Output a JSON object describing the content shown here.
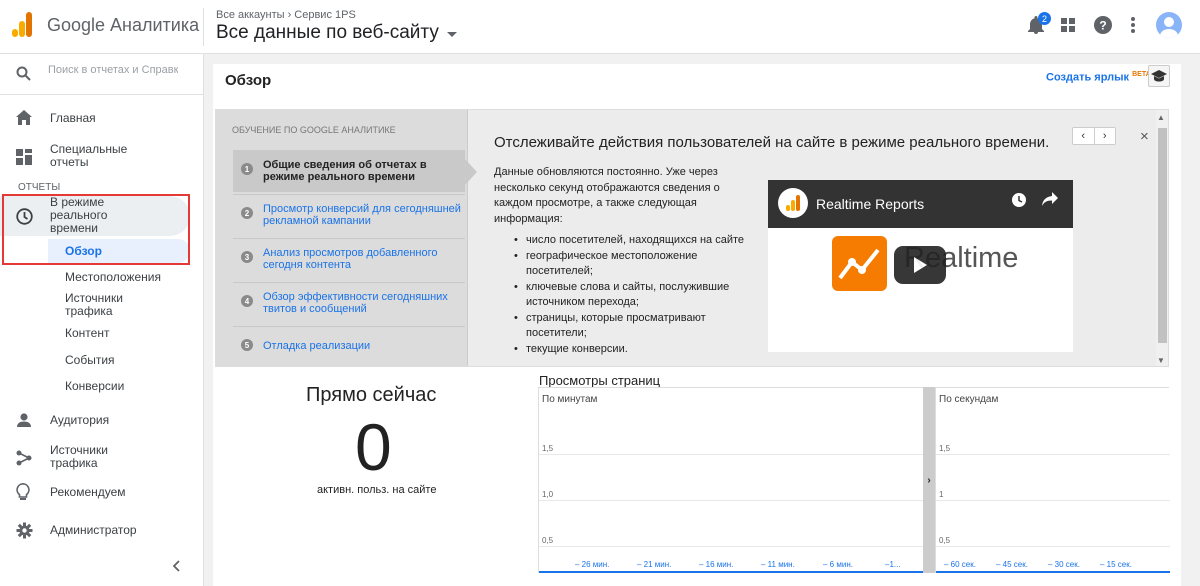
{
  "header": {
    "app_title": "Google Аналитика",
    "breadcrumb": "Все аккаунты › Сервис 1PS",
    "view_name": "Все данные по веб-сайту",
    "notification_count": "2",
    "brand_colors": {
      "logo_light": "#f9ab00",
      "logo_dark": "#e37400",
      "accent": "#1a73e8"
    }
  },
  "sidebar": {
    "search_placeholder": "Поиск в отчетах и Справке",
    "home": "Главная",
    "custom_reports": "Специальные отчеты",
    "section_reports": "ОТЧЕТЫ",
    "realtime": "В режиме реального времени",
    "realtime_sub": [
      "Обзор",
      "Местоположения",
      "Источники трафика",
      "Контент",
      "События",
      "Конверсии"
    ],
    "audience": "Аудитория",
    "acquisition": "Источники трафика",
    "recommended": "Рекомендуем",
    "admin": "Администратор"
  },
  "main": {
    "page_title": "Обзор",
    "shortcut_label": "Создать ярлык",
    "shortcut_badge": "BETA",
    "learning": {
      "heading": "ОБУЧЕНИЕ ПО GOOGLE АНАЛИТИКЕ",
      "steps": [
        {
          "num": "1",
          "label": "Общие сведения об отчетах в режиме реального времени"
        },
        {
          "num": "2",
          "label": "Просмотр конверсий для сегодняшней рекламной кампании"
        },
        {
          "num": "3",
          "label": "Анализ просмотров добавленного сегодня контента"
        },
        {
          "num": "4",
          "label": "Обзор эффективности сегодняшних твитов и сообщений"
        },
        {
          "num": "5",
          "label": "Отладка реализации"
        }
      ],
      "title": "Отслеживайте действия пользователей на сайте в режиме реального времени.",
      "body": "Данные обновляются постоянно. Уже через несколько секунд отображаются сведения о каждом просмотре, а также следующая информация:",
      "bullets": [
        "число посетителей, находящихся на сайте",
        "географическое местоположение посетителей;",
        "ключевые слова и сайты, послужившие источником перехода;",
        "страницы, которые просматривают посетители;",
        "текущие конверсии."
      ],
      "video_title": "Realtime Reports",
      "video_text": "Realtime"
    },
    "right_now": {
      "title": "Прямо сейчас",
      "value": "0",
      "subtitle": "активн. польз. на сайте"
    },
    "pageviews_title": "Просмотры страниц"
  },
  "chart_data": [
    {
      "type": "bar",
      "title": "По минутам",
      "yticks": [
        "1,5",
        "1,0",
        "0,5"
      ],
      "categories": [
        "– 26 мин.",
        "– 21 мин.",
        "– 16 мин.",
        "– 11 мин.",
        "– 6 мин.",
        "–1..."
      ],
      "values": [
        0,
        0,
        0,
        0,
        0,
        0
      ],
      "ylim": [
        0,
        2
      ]
    },
    {
      "type": "bar",
      "title": "По секундам",
      "yticks": [
        "1,5",
        "1",
        "0,5"
      ],
      "categories": [
        "– 60 сек.",
        "– 45 сек.",
        "– 30 сек.",
        "– 15 сек."
      ],
      "values": [
        0,
        0,
        0,
        0
      ],
      "ylim": [
        0,
        2
      ]
    }
  ]
}
